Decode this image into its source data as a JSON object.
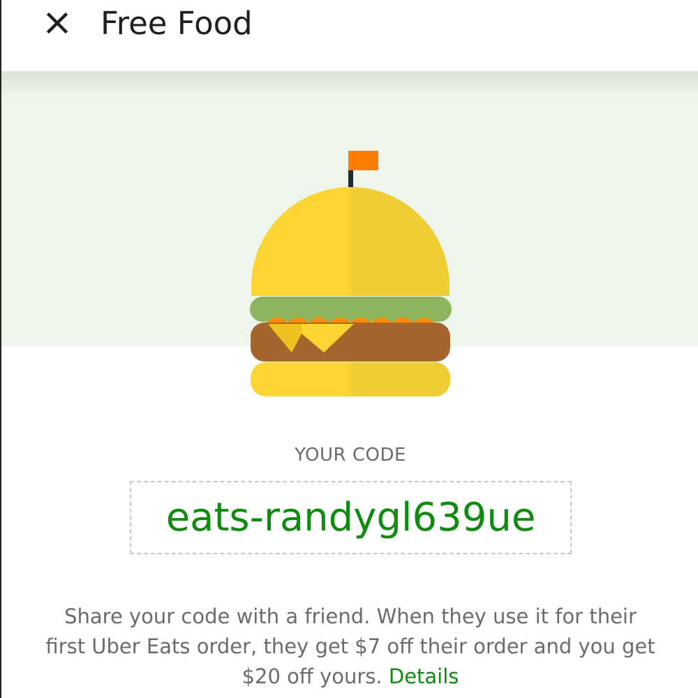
{
  "header": {
    "title": "Free Food",
    "close_icon": "close-icon"
  },
  "hero": {
    "illustration": "burger-with-flag-illustration",
    "background_color": "#eef5ea"
  },
  "colors": {
    "accent_green": "#108a10",
    "bun_yellow": "#fcd535",
    "bun_shade": "#f0cc35",
    "lettuce_green": "#8db55d",
    "patty_brown": "#a5652c",
    "cheese_yellow": "#f9c531",
    "flag_orange": "#ff7e00",
    "pole_dark": "#1e2b35",
    "text_gray": "#6b6b6b"
  },
  "referral": {
    "code_label": "YOUR CODE",
    "code_value": "eats-randygl639ue",
    "description": "Share your code with a friend. When they use it for their first Uber Eats order, they get $7 off their order and you get $20 off yours.",
    "details_link": "Details"
  }
}
